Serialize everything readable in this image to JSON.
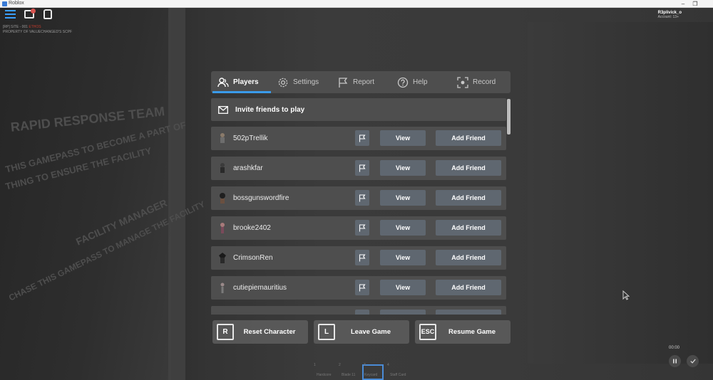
{
  "window": {
    "title": "Roblox",
    "min_glyph": "–",
    "max_glyph": "❐"
  },
  "hud": {
    "line1": "[RP] SITE - 001 ",
    "line1_red": "ETHOS",
    "line2": "PROPERTY OF VALUECHANGED'S SCPF",
    "icons": [
      "hamburger-menu-icon",
      "chat-icon",
      "backpack-icon"
    ]
  },
  "account": {
    "username": "R3plivick_o",
    "age": "Account: 13+"
  },
  "background_text": [
    "RAPID RESPONSE TEAM",
    "THIS GAMEPASS TO BECOME A PART OF",
    "THING TO ENSURE THE FACILITY",
    "FACILITY MANAGER",
    "CHASE THIS GAMEPASS TO MANAGE THE FACILITY"
  ],
  "tabs": [
    {
      "label": "Players",
      "icon": "players-icon",
      "active": true
    },
    {
      "label": "Settings",
      "icon": "gear-icon",
      "active": false
    },
    {
      "label": "Report",
      "icon": "flag-icon",
      "active": false
    },
    {
      "label": "Help",
      "icon": "question-icon",
      "active": false
    },
    {
      "label": "Record",
      "icon": "record-icon",
      "active": false
    }
  ],
  "invite": {
    "label": "Invite friends to play",
    "icon": "mail-icon"
  },
  "players": [
    {
      "name": "502pTrellik",
      "view": "View",
      "add": "Add Friend"
    },
    {
      "name": "arashkfar",
      "view": "View",
      "add": "Add Friend"
    },
    {
      "name": "bossgunswordfire",
      "view": "View",
      "add": "Add Friend"
    },
    {
      "name": "brooke2402",
      "view": "View",
      "add": "Add Friend"
    },
    {
      "name": "CrimsonRen",
      "view": "View",
      "add": "Add Friend"
    },
    {
      "name": "cutiepiemauritius",
      "view": "View",
      "add": "Add Friend"
    }
  ],
  "actions": [
    {
      "key": "R",
      "label": "Reset Character"
    },
    {
      "key": "L",
      "label": "Leave Game"
    },
    {
      "key": "ESC",
      "label": "Resume Game"
    }
  ],
  "hotbar": [
    {
      "num": "1",
      "label": "Hardcore"
    },
    {
      "num": "2",
      "label": "Blade 11"
    },
    {
      "num": "3",
      "label": "Keycard"
    },
    {
      "num": "4",
      "label": "Staff Card"
    }
  ],
  "recording": {
    "time": "00:00"
  },
  "colors": {
    "accent": "#3a9bea",
    "button": "#5f6770",
    "panel": "#505050"
  }
}
